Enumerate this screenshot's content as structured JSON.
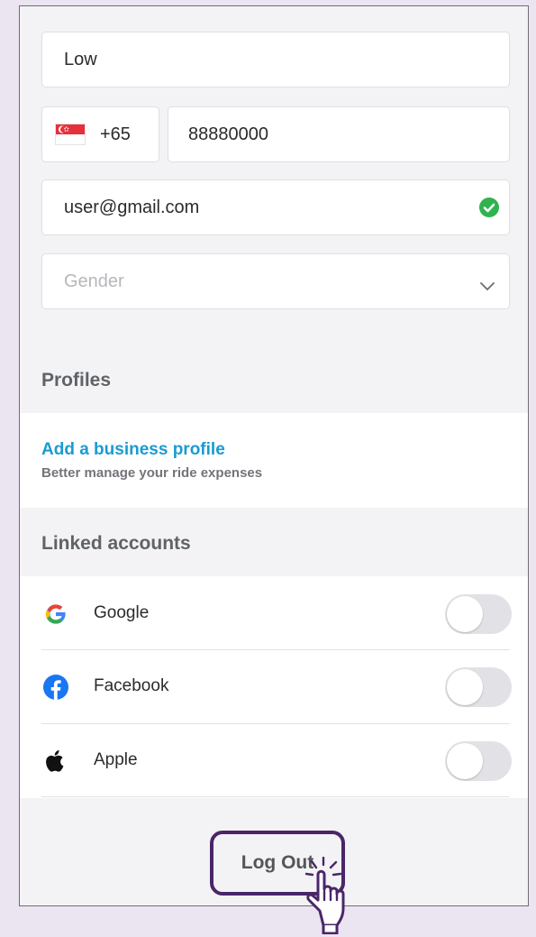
{
  "form": {
    "last_name": "Low",
    "country_code": "+65",
    "phone_number": "88880000",
    "email": "user@gmail.com",
    "gender_placeholder": "Gender"
  },
  "profiles": {
    "section_title": "Profiles",
    "add_business_label": "Add a business profile",
    "add_business_sub": "Better manage your ride expenses"
  },
  "linked_accounts": {
    "section_title": "Linked accounts",
    "items": [
      {
        "name": "Google",
        "icon": "google-icon",
        "enabled": false
      },
      {
        "name": "Facebook",
        "icon": "facebook-icon",
        "enabled": false
      },
      {
        "name": "Apple",
        "icon": "apple-icon",
        "enabled": false
      }
    ]
  },
  "logout_label": "Log Out",
  "colors": {
    "accent_link": "#1a9bd1",
    "success": "#2fb34f",
    "highlight": "#4a2669"
  }
}
